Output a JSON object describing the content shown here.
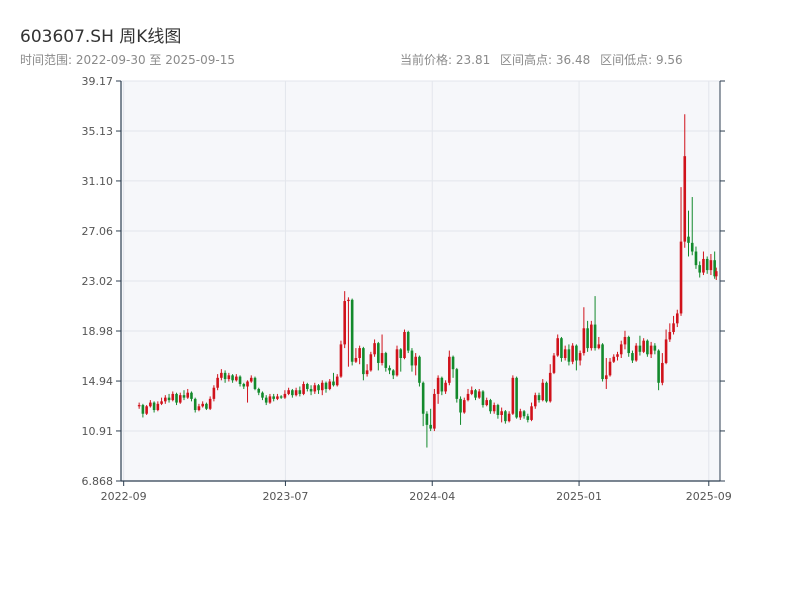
{
  "header": {
    "title": "603607.SH 周K线图",
    "range": "时间范围: 2022-09-30 至 2025-09-15",
    "current_price": "当前价格: 23.81",
    "high": "区间高点: 36.48",
    "low": "区间低点: 9.56"
  },
  "colors": {
    "up": "#d0121b",
    "down": "#138a2c",
    "plot_bg": "#f6f7fa",
    "grid": "#e3e6ec",
    "axis": "#2c3e50"
  },
  "chart_data": {
    "type": "candlestick",
    "title": "603607.SH 周K线图",
    "ylim": [
      6.868,
      39.17
    ],
    "y_ticks": [
      6.868,
      10.91,
      14.94,
      18.98,
      23.02,
      27.06,
      31.1,
      35.13,
      39.17
    ],
    "y_tick_labels": [
      "6.868",
      "10.91",
      "14.94",
      "18.98",
      "23.02",
      "27.06",
      "31.10",
      "35.13",
      "39.17"
    ],
    "x_start": "2022-09-30",
    "x_end": "2025-09-15",
    "x_ticks": [
      "2022-09-01",
      "2023-07-01",
      "2024-04-01",
      "2025-01-01",
      "2025-09-01"
    ],
    "x_tick_labels": [
      "2022-09",
      "2023-07",
      "2024-04",
      "2025-01",
      "2025-09"
    ],
    "grid": true,
    "candles": [
      [
        "2022-09-30",
        12.9,
        13.0,
        13.2,
        12.7
      ],
      [
        "2022-10-07",
        13.0,
        12.3,
        13.1,
        12.0
      ],
      [
        "2022-10-14",
        12.3,
        12.9,
        13.0,
        12.2
      ],
      [
        "2022-10-21",
        12.9,
        13.2,
        13.4,
        12.8
      ],
      [
        "2022-10-28",
        13.2,
        12.6,
        13.3,
        12.4
      ],
      [
        "2022-11-04",
        12.6,
        13.1,
        13.3,
        12.5
      ],
      [
        "2022-11-11",
        13.1,
        13.3,
        13.6,
        13.0
      ],
      [
        "2022-11-18",
        13.3,
        13.6,
        13.8,
        13.1
      ],
      [
        "2022-11-25",
        13.6,
        13.4,
        13.9,
        13.2
      ],
      [
        "2022-12-02",
        13.4,
        13.9,
        14.1,
        13.3
      ],
      [
        "2022-12-09",
        13.9,
        13.2,
        14.0,
        13.0
      ],
      [
        "2022-12-16",
        13.2,
        13.8,
        14.0,
        13.1
      ],
      [
        "2022-12-23",
        13.8,
        13.6,
        14.2,
        13.4
      ],
      [
        "2022-12-30",
        13.6,
        14.0,
        14.3,
        13.5
      ],
      [
        "2023-01-06",
        14.0,
        13.5,
        14.1,
        13.3
      ],
      [
        "2023-01-13",
        13.5,
        12.6,
        13.6,
        12.4
      ],
      [
        "2023-01-20",
        12.6,
        12.9,
        13.1,
        12.5
      ],
      [
        "2023-01-27",
        12.9,
        13.1,
        13.3,
        12.8
      ],
      [
        "2023-02-03",
        13.1,
        12.7,
        13.2,
        12.6
      ],
      [
        "2023-02-10",
        12.7,
        13.5,
        13.7,
        12.6
      ],
      [
        "2023-02-17",
        13.5,
        14.4,
        14.6,
        13.3
      ],
      [
        "2023-02-24",
        14.4,
        15.2,
        15.5,
        14.2
      ],
      [
        "2023-03-03",
        15.2,
        15.6,
        15.9,
        15.0
      ],
      [
        "2023-03-10",
        15.6,
        15.1,
        15.8,
        14.8
      ],
      [
        "2023-03-17",
        15.1,
        15.4,
        15.6,
        14.9
      ],
      [
        "2023-03-24",
        15.4,
        15.0,
        15.5,
        14.8
      ],
      [
        "2023-03-31",
        15.0,
        15.3,
        15.5,
        14.9
      ],
      [
        "2023-04-07",
        15.3,
        14.7,
        15.4,
        14.5
      ],
      [
        "2023-04-14",
        14.7,
        14.5,
        14.8,
        14.3
      ],
      [
        "2023-04-21",
        14.5,
        14.9,
        15.0,
        13.2
      ],
      [
        "2023-04-28",
        14.9,
        15.2,
        15.4,
        14.8
      ],
      [
        "2023-05-05",
        15.2,
        14.3,
        15.3,
        14.2
      ],
      [
        "2023-05-12",
        14.3,
        14.0,
        14.4,
        13.8
      ],
      [
        "2023-05-19",
        14.0,
        13.6,
        14.1,
        13.4
      ],
      [
        "2023-05-26",
        13.6,
        13.2,
        13.8,
        13.0
      ],
      [
        "2023-06-02",
        13.2,
        13.7,
        13.9,
        13.1
      ],
      [
        "2023-06-09",
        13.7,
        13.5,
        13.9,
        13.3
      ],
      [
        "2023-06-16",
        13.5,
        13.7,
        13.9,
        13.4
      ],
      [
        "2023-06-23",
        13.7,
        13.6,
        13.8,
        13.5
      ],
      [
        "2023-06-30",
        13.6,
        13.9,
        14.2,
        13.5
      ],
      [
        "2023-07-07",
        13.9,
        14.2,
        14.4,
        13.8
      ],
      [
        "2023-07-14",
        14.2,
        13.8,
        14.3,
        13.6
      ],
      [
        "2023-07-21",
        13.8,
        14.2,
        14.4,
        13.7
      ],
      [
        "2023-07-28",
        14.2,
        13.9,
        14.5,
        13.7
      ],
      [
        "2023-08-04",
        13.9,
        14.7,
        14.9,
        13.8
      ],
      [
        "2023-08-11",
        14.7,
        14.3,
        14.8,
        14.1
      ],
      [
        "2023-08-18",
        14.3,
        14.1,
        14.6,
        13.8
      ],
      [
        "2023-08-25",
        14.1,
        14.6,
        14.8,
        13.9
      ],
      [
        "2023-09-01",
        14.6,
        14.2,
        14.7,
        13.9
      ],
      [
        "2023-09-08",
        14.2,
        14.8,
        15.0,
        13.8
      ],
      [
        "2023-09-15",
        14.8,
        14.3,
        14.9,
        14.0
      ],
      [
        "2023-09-22",
        14.3,
        14.9,
        15.1,
        14.2
      ],
      [
        "2023-09-29",
        14.9,
        14.6,
        15.6,
        14.5
      ],
      [
        "2023-10-06",
        14.6,
        15.3,
        15.5,
        14.5
      ],
      [
        "2023-10-13",
        15.3,
        17.9,
        18.2,
        15.2
      ],
      [
        "2023-10-20",
        17.9,
        21.4,
        22.2,
        17.6
      ],
      [
        "2023-10-27",
        21.4,
        21.5,
        21.7,
        16.1
      ],
      [
        "2023-11-03",
        21.5,
        16.5,
        21.6,
        16.2
      ],
      [
        "2023-11-10",
        16.5,
        16.8,
        17.6,
        16.4
      ],
      [
        "2023-11-17",
        16.8,
        17.6,
        17.8,
        16.3
      ],
      [
        "2023-11-24",
        17.6,
        15.5,
        17.7,
        15.0
      ],
      [
        "2023-12-01",
        15.5,
        15.8,
        16.3,
        15.3
      ],
      [
        "2023-12-08",
        15.8,
        17.1,
        17.3,
        15.7
      ],
      [
        "2023-12-15",
        17.1,
        18.0,
        18.3,
        16.9
      ],
      [
        "2023-12-22",
        18.0,
        16.4,
        18.1,
        15.8
      ],
      [
        "2023-12-29",
        16.4,
        17.2,
        18.7,
        16.2
      ],
      [
        "2024-01-05",
        17.2,
        16.0,
        17.3,
        15.7
      ],
      [
        "2024-01-12",
        16.0,
        15.8,
        16.2,
        15.5
      ],
      [
        "2024-01-19",
        15.8,
        15.4,
        15.9,
        15.1
      ],
      [
        "2024-01-26",
        15.4,
        17.5,
        17.8,
        15.3
      ],
      [
        "2024-02-02",
        17.5,
        16.8,
        17.6,
        15.7
      ],
      [
        "2024-02-09",
        16.8,
        18.9,
        19.1,
        16.7
      ],
      [
        "2024-02-16",
        18.9,
        17.4,
        19.0,
        17.2
      ],
      [
        "2024-02-23",
        17.4,
        16.2,
        17.6,
        15.7
      ],
      [
        "2024-03-01",
        16.2,
        16.9,
        17.2,
        15.4
      ],
      [
        "2024-03-08",
        16.9,
        14.8,
        17.0,
        14.5
      ],
      [
        "2024-03-15",
        14.8,
        12.3,
        14.9,
        11.3
      ],
      [
        "2024-03-22",
        12.3,
        11.4,
        12.5,
        9.57
      ],
      [
        "2024-03-29",
        11.4,
        11.1,
        12.7,
        10.9
      ],
      [
        "2024-04-05",
        11.1,
        13.9,
        14.3,
        10.9
      ],
      [
        "2024-04-12",
        13.9,
        15.2,
        15.4,
        13.1
      ],
      [
        "2024-04-19",
        15.2,
        14.1,
        15.3,
        13.8
      ],
      [
        "2024-04-26",
        14.1,
        14.8,
        15.0,
        13.9
      ],
      [
        "2024-05-03",
        14.8,
        16.9,
        17.4,
        14.6
      ],
      [
        "2024-05-10",
        16.9,
        15.9,
        17.0,
        15.2
      ],
      [
        "2024-05-17",
        15.9,
        13.5,
        16.0,
        13.2
      ],
      [
        "2024-05-24",
        13.5,
        12.4,
        13.7,
        11.4
      ],
      [
        "2024-05-31",
        12.4,
        13.4,
        13.6,
        12.3
      ],
      [
        "2024-06-07",
        13.4,
        13.9,
        14.3,
        13.3
      ],
      [
        "2024-06-14",
        13.9,
        14.2,
        14.5,
        13.8
      ],
      [
        "2024-06-21",
        14.2,
        13.6,
        14.3,
        13.4
      ],
      [
        "2024-06-28",
        13.6,
        14.1,
        14.3,
        13.5
      ],
      [
        "2024-07-05",
        14.1,
        13.0,
        14.2,
        12.8
      ],
      [
        "2024-07-12",
        13.0,
        13.4,
        13.6,
        12.9
      ],
      [
        "2024-07-19",
        13.4,
        12.5,
        13.5,
        12.3
      ],
      [
        "2024-07-26",
        12.5,
        13.0,
        13.2,
        12.3
      ],
      [
        "2024-08-02",
        13.0,
        12.2,
        13.1,
        11.9
      ],
      [
        "2024-08-09",
        12.2,
        12.5,
        12.8,
        11.6
      ],
      [
        "2024-08-16",
        12.5,
        11.7,
        12.6,
        11.5
      ],
      [
        "2024-08-23",
        11.7,
        12.3,
        12.5,
        11.6
      ],
      [
        "2024-08-30",
        12.3,
        15.2,
        15.4,
        12.2
      ],
      [
        "2024-09-06",
        15.2,
        12.0,
        15.3,
        11.9
      ],
      [
        "2024-09-13",
        12.0,
        12.5,
        12.7,
        11.8
      ],
      [
        "2024-09-20",
        12.5,
        12.1,
        12.6,
        11.9
      ],
      [
        "2024-09-27",
        12.1,
        11.8,
        12.3,
        11.6
      ],
      [
        "2024-10-04",
        11.8,
        12.9,
        13.2,
        11.7
      ],
      [
        "2024-10-11",
        12.9,
        13.8,
        14.0,
        12.7
      ],
      [
        "2024-10-18",
        13.8,
        13.4,
        14.0,
        13.2
      ],
      [
        "2024-10-25",
        13.4,
        14.8,
        15.1,
        13.3
      ],
      [
        "2024-11-01",
        14.8,
        13.3,
        14.9,
        13.2
      ],
      [
        "2024-11-08",
        13.3,
        15.6,
        16.3,
        13.2
      ],
      [
        "2024-11-15",
        15.6,
        17.0,
        17.2,
        15.5
      ],
      [
        "2024-11-22",
        17.0,
        18.4,
        18.7,
        16.9
      ],
      [
        "2024-11-29",
        18.4,
        16.8,
        18.5,
        16.5
      ],
      [
        "2024-12-06",
        16.8,
        17.5,
        17.8,
        16.6
      ],
      [
        "2024-12-13",
        17.5,
        16.5,
        17.9,
        16.2
      ],
      [
        "2024-12-20",
        16.5,
        17.8,
        18.0,
        16.3
      ],
      [
        "2024-12-27",
        17.8,
        16.6,
        17.9,
        15.8
      ],
      [
        "2025-01-03",
        16.6,
        17.2,
        17.4,
        16.2
      ],
      [
        "2025-01-10",
        17.2,
        19.2,
        20.9,
        17.0
      ],
      [
        "2025-01-17",
        19.2,
        17.6,
        19.8,
        17.3
      ],
      [
        "2025-01-24",
        17.6,
        19.5,
        19.8,
        17.4
      ],
      [
        "2025-01-31",
        19.5,
        17.6,
        21.8,
        17.4
      ],
      [
        "2025-02-07",
        17.6,
        17.9,
        18.5,
        17.5
      ],
      [
        "2025-02-14",
        17.9,
        15.1,
        18.0,
        14.9
      ],
      [
        "2025-02-21",
        15.1,
        15.4,
        16.8,
        14.3
      ],
      [
        "2025-02-28",
        15.4,
        16.5,
        16.8,
        15.3
      ],
      [
        "2025-03-07",
        16.5,
        16.9,
        17.1,
        16.4
      ],
      [
        "2025-03-14",
        16.9,
        17.1,
        17.3,
        16.6
      ],
      [
        "2025-03-21",
        17.1,
        17.9,
        18.2,
        16.8
      ],
      [
        "2025-03-28",
        17.9,
        18.5,
        19.0,
        17.5
      ],
      [
        "2025-04-04",
        18.5,
        17.2,
        18.6,
        16.9
      ],
      [
        "2025-04-11",
        17.2,
        16.6,
        17.4,
        16.4
      ],
      [
        "2025-04-18",
        16.6,
        17.8,
        18.0,
        16.5
      ],
      [
        "2025-04-25",
        17.8,
        17.3,
        18.6,
        17.0
      ],
      [
        "2025-05-02",
        17.3,
        18.2,
        18.4,
        17.2
      ],
      [
        "2025-05-09",
        18.2,
        17.1,
        18.3,
        16.9
      ],
      [
        "2025-05-16",
        17.1,
        17.8,
        18.1,
        16.8
      ],
      [
        "2025-05-23",
        17.8,
        17.4,
        18.0,
        17.1
      ],
      [
        "2025-05-30",
        17.4,
        14.8,
        17.5,
        14.2
      ],
      [
        "2025-06-06",
        14.8,
        16.4,
        17.2,
        14.6
      ],
      [
        "2025-06-13",
        16.4,
        18.3,
        19.1,
        16.3
      ],
      [
        "2025-06-20",
        18.3,
        18.9,
        19.6,
        18.1
      ],
      [
        "2025-06-27",
        18.9,
        19.6,
        20.2,
        18.7
      ],
      [
        "2025-07-04",
        19.6,
        20.4,
        20.7,
        19.3
      ],
      [
        "2025-07-11",
        20.4,
        26.2,
        30.6,
        20.2
      ],
      [
        "2025-07-18",
        26.2,
        33.1,
        36.48,
        25.7
      ],
      [
        "2025-07-25",
        26.6,
        26.1,
        28.7,
        25.0
      ],
      [
        "2025-08-01",
        26.1,
        25.4,
        29.8,
        25.1
      ],
      [
        "2025-08-08",
        25.4,
        24.3,
        25.8,
        24.0
      ],
      [
        "2025-08-15",
        24.3,
        23.7,
        24.6,
        23.3
      ],
      [
        "2025-08-22",
        23.7,
        24.8,
        25.4,
        23.5
      ],
      [
        "2025-08-29",
        24.8,
        23.9,
        25.0,
        23.6
      ],
      [
        "2025-09-05",
        23.9,
        24.7,
        25.2,
        23.5
      ],
      [
        "2025-09-12",
        24.7,
        23.4,
        25.4,
        23.2
      ],
      [
        "2025-09-15",
        23.4,
        23.81,
        24.1,
        23.1
      ]
    ]
  }
}
